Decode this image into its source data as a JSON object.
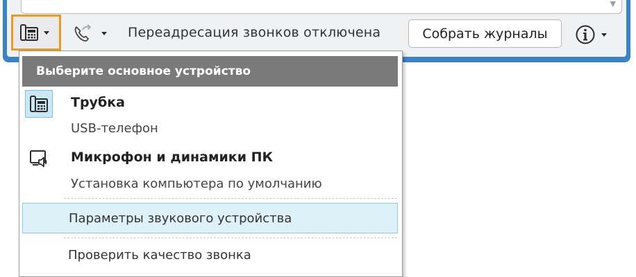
{
  "toolbar": {
    "device_button": {
      "icon": "desk-phone-icon",
      "active_border_color": "#e99a1f"
    },
    "forward_button": {
      "icon": "call-forward-icon"
    },
    "forward_status": "Переадресация звонков отключена",
    "collect_logs_label": "Собрать журналы",
    "info_button": {
      "icon": "info-icon"
    }
  },
  "menu": {
    "header": "Выберите основное устройство",
    "devices": [
      {
        "title": "Трубка",
        "subtitle": "USB-телефон",
        "icon": "desk-phone-icon",
        "selected": true
      },
      {
        "title": "Микрофон и динамики ПК",
        "subtitle": "Установка компьютера по умолчанию",
        "icon": "pc-speaker-icon",
        "selected": false
      }
    ],
    "items": [
      {
        "label": "Параметры звукового устройства",
        "highlighted": true
      },
      {
        "label": "Проверить качество звонка",
        "highlighted": false
      }
    ]
  },
  "colors": {
    "window_frame": "#3c83c6",
    "highlight_bg": "#dcf1f8",
    "header_bg": "#7a7a7a"
  }
}
